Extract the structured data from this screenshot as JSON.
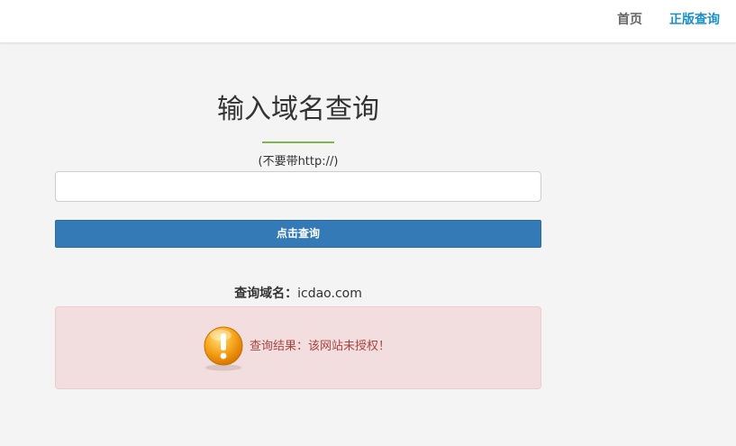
{
  "nav": {
    "home_label": "首页",
    "genuine_label": "正版查询",
    "active_color": "#1a8fd0"
  },
  "main": {
    "title": "输入域名查询",
    "hint": "(不要带http://)",
    "input_value": "",
    "button_label": "点击查询",
    "queried_label": "查询域名：",
    "queried_domain": "icdao.com"
  },
  "result": {
    "icon": "exclamation-warning-icon",
    "message": "查询结果：该网站未授权！",
    "color": "#a94442"
  }
}
